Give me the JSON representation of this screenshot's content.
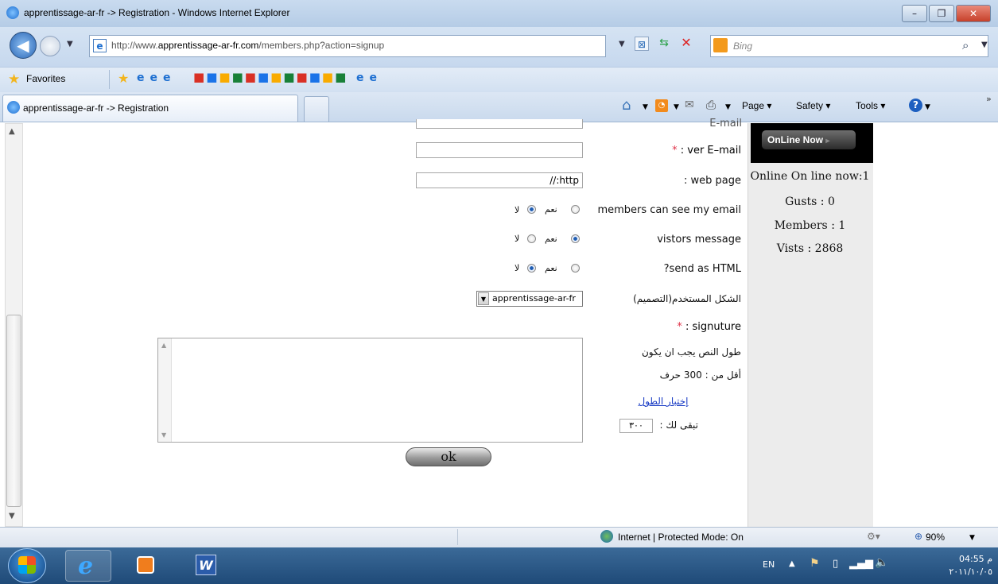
{
  "window": {
    "title": "apprentissage-ar-fr -> Registration - Windows Internet Explorer",
    "minimize": "–",
    "maximize": "❐",
    "close": "✕"
  },
  "address_bar": {
    "url_prefix": "http://www.",
    "url_domain": "apprentissage-ar-fr.com",
    "url_suffix": "/members.php?action=signup",
    "search_placeholder": "Bing"
  },
  "favorites": {
    "label": "Favorites"
  },
  "tabs": [
    {
      "label": "apprentissage-ar-fr -> Registration"
    }
  ],
  "command_bar": {
    "page": "Page ▾",
    "safety": "Safety ▾",
    "tools": "Tools ▾"
  },
  "form": {
    "email_label": "E-mail",
    "ver_email_star": "*",
    "ver_email_label": ": ver E–mail",
    "web_page_label": ": web page",
    "web_page_value": "//:http",
    "see_email_label": "members can see my email",
    "visitors_message_label": "vistors message",
    "send_html_label": "?send as HTML",
    "yes": "نعم",
    "no": "لا",
    "style_label": "الشكل المستخدم(التصميم)",
    "style_value": "apprentissage-ar-fr",
    "signature_star": "*",
    "signature_label": ": signuture",
    "length_note_line1": "طول النص يجب ان يكون",
    "length_note_line2": "أقل من : 300 حرف",
    "test_length_link": "إختبار الطول",
    "remaining_label": "تبقى لك :",
    "remaining_value": "٣٠٠",
    "submit": "ok"
  },
  "sidebar": {
    "online_now": "OnLine Now",
    "online_line": "Online On line now:1",
    "guests": "Gusts : 0",
    "members": "Members : 1",
    "visits": "Vists : 2868"
  },
  "status_bar": {
    "zone": "Internet | Protected Mode: On",
    "zoom": "90%"
  },
  "taskbar": {
    "lang": "EN",
    "time": "04:55 م",
    "date": "٢٠١١/١٠/٠٥"
  }
}
